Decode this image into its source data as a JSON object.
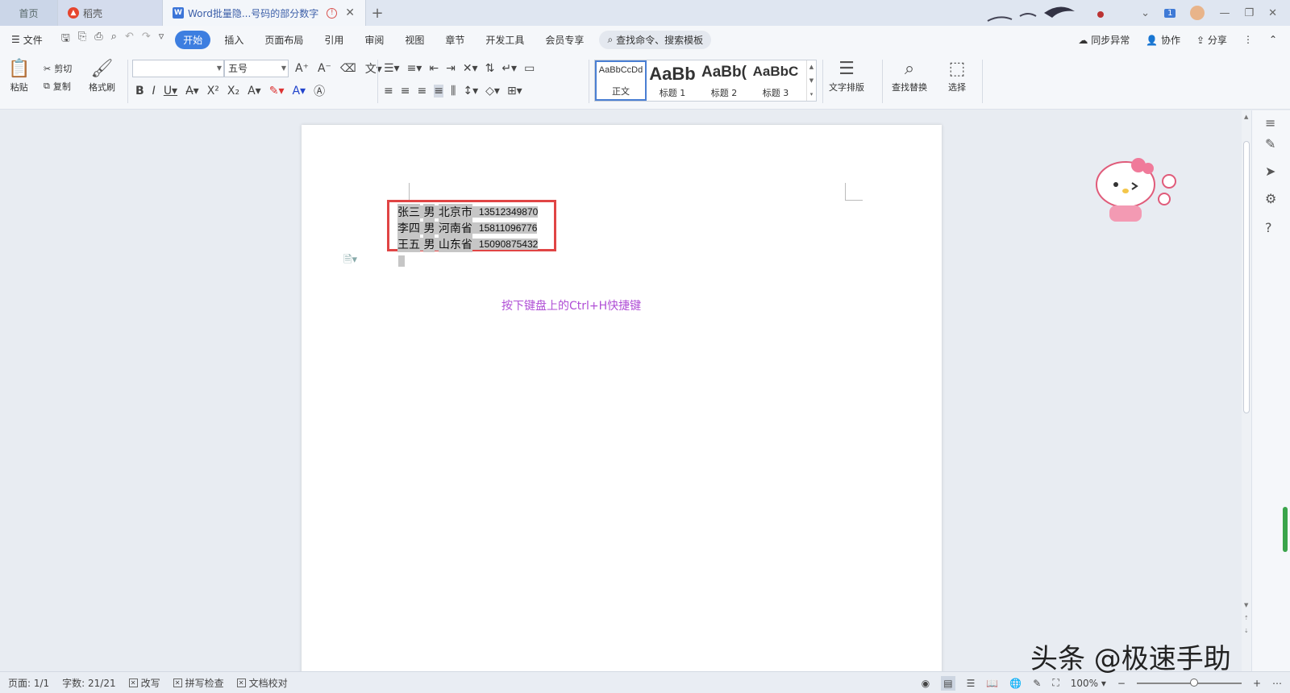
{
  "tabs": [
    {
      "label": "首页"
    },
    {
      "label": "稻壳"
    },
    {
      "label": "Word批量隐...号码的部分数字"
    }
  ],
  "window": {
    "badge": "1"
  },
  "menu": {
    "file": "文件",
    "items": [
      "开始",
      "插入",
      "页面布局",
      "引用",
      "审阅",
      "视图",
      "章节",
      "开发工具",
      "会员专享"
    ],
    "search": "查找命令、搜索模板",
    "sync": "同步异常",
    "collab": "协作",
    "share": "分享"
  },
  "ribbon": {
    "paste": "粘贴",
    "cut": "剪切",
    "copy": "复制",
    "format_painter": "格式刷",
    "font_name": "",
    "font_size": "五号",
    "styles": [
      {
        "sample": "AaBbCcDd",
        "name": "正文"
      },
      {
        "sample": "AaBb",
        "name": "标题 1"
      },
      {
        "sample": "AaBb(",
        "name": "标题 2"
      },
      {
        "sample": "AaBbC",
        "name": "标题 3"
      }
    ],
    "text_layout": "文字排版",
    "find_replace": "查找替换",
    "select": "选择"
  },
  "document": {
    "rows": [
      {
        "name": "张三",
        "gender": "男",
        "city": "北京市",
        "phone": "13512349870"
      },
      {
        "name": "李四",
        "gender": "男",
        "city": "河南省",
        "phone": "15811096776"
      },
      {
        "name": "王五",
        "gender": "男",
        "city": "山东省",
        "phone": "15090875432"
      }
    ],
    "annotation": "按下键盘上的Ctrl+H快捷键"
  },
  "status": {
    "page": "页面: 1/1",
    "words": "字数: 21/21",
    "revise": "改写",
    "spell": "拼写检查",
    "proof": "文档校对",
    "zoom": "100%"
  },
  "watermark": "头条 @极速手助"
}
